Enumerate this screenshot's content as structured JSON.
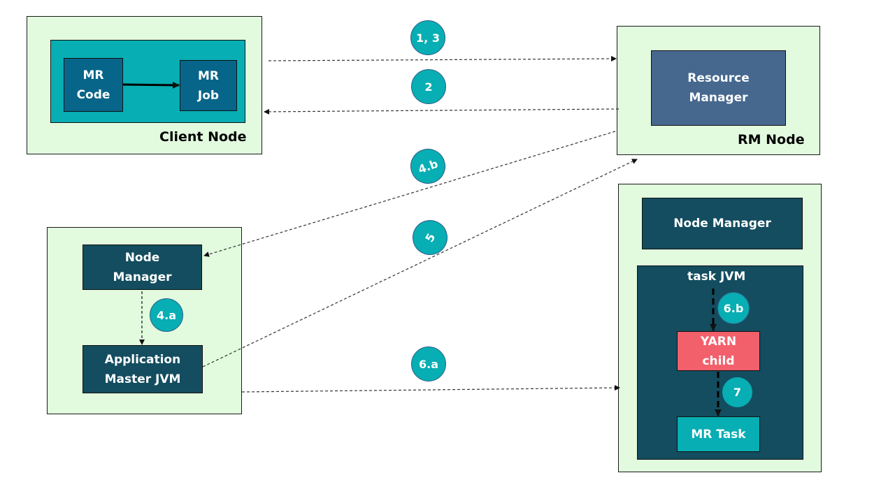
{
  "diagram": {
    "client_node": {
      "label": "Client Node",
      "mr_code": "MR\nCode",
      "mr_job": "MR\nJob"
    },
    "rm_node": {
      "label": "RM Node",
      "resource_manager": "Resource\nManager"
    },
    "am_node": {
      "node_manager": "Node\nManager",
      "app_master": "Application\nMaster JVM"
    },
    "worker_node": {
      "node_manager": "Node Manager",
      "task_jvm": "task JVM",
      "yarn_child": "YARN\nchild",
      "mr_task": "MR Task"
    },
    "steps": {
      "s13": "1, 3",
      "s2": "2",
      "s4b": "4.b",
      "s4a": "4.a",
      "s5": "5",
      "s6a": "6.a",
      "s6b": "6.b",
      "s7": "7"
    },
    "colors": {
      "node_bg": "#e2fbdf",
      "teal": "#07aeb3",
      "dark_teal": "#134d5f",
      "mr_blue": "#076589",
      "rm_blue": "#46688f",
      "yarn_red": "#f2606c"
    }
  }
}
